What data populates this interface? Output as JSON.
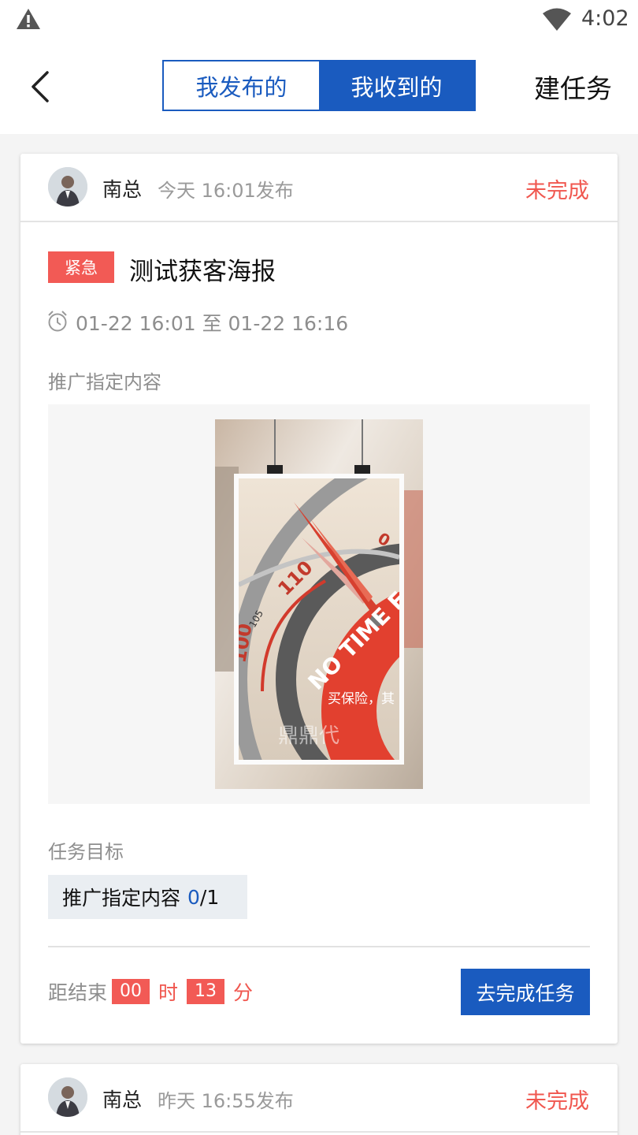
{
  "status_bar": {
    "time": "4:02"
  },
  "nav": {
    "tabs": [
      {
        "label": "我发布的",
        "selected": false
      },
      {
        "label": "我收到的",
        "selected": true
      }
    ],
    "create_label": "建任务"
  },
  "colors": {
    "accent": "#1a5bbf",
    "urgent": "#f25a55",
    "status": "#f0574f"
  },
  "tasks": [
    {
      "publisher": "南总",
      "published": "今天 16:01发布",
      "status": "未完成",
      "priority": "紧急",
      "title": "测试获客海报",
      "time_range": "01-22 16:01 至 01-22 16:16",
      "content_label": "推广指定内容",
      "poster_text": {
        "dial_numbers": [
          "110",
          "105",
          "100",
          "0"
        ],
        "badge": "NO TIME FO",
        "caption": "买保险，其",
        "watermark": "鼎鼎代"
      },
      "goal_label": "任务目标",
      "goal": {
        "name": "推广指定内容",
        "done": "0",
        "total": "/1"
      },
      "countdown": {
        "label": "距结束",
        "hours": "00",
        "hours_unit": "时",
        "minutes": "13",
        "minutes_unit": "分"
      },
      "action": "去完成任务"
    },
    {
      "publisher": "南总",
      "published": "昨天 16:55发布",
      "status": "未完成"
    }
  ]
}
